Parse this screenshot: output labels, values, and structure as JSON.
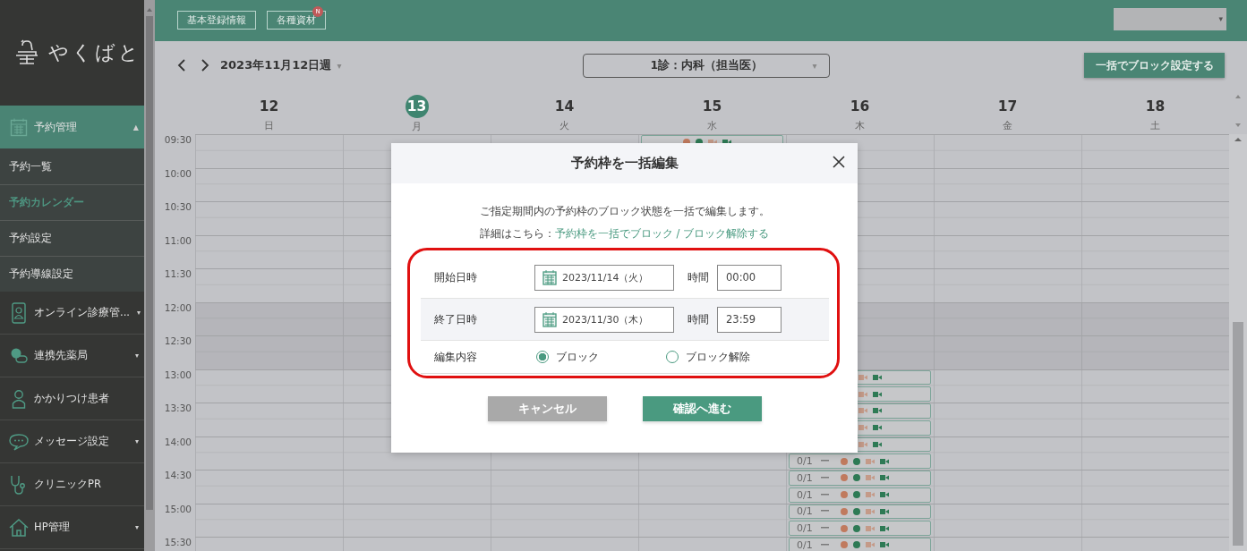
{
  "sidebar": {
    "logo": "やくばと",
    "items": [
      {
        "label": "予約管理",
        "caret": "▲",
        "selected": true,
        "children": [
          {
            "label": "予約一覧",
            "selected": false
          },
          {
            "label": "予約カレンダー",
            "selected": true
          },
          {
            "label": "予約設定",
            "selected": false
          },
          {
            "label": "予約導線設定",
            "selected": false
          }
        ]
      },
      {
        "label": "オンライン診療管...",
        "caret": "▾",
        "selected": false
      },
      {
        "label": "連携先薬局",
        "caret": "▾",
        "selected": false
      },
      {
        "label": "かかりつけ患者",
        "selected": false
      },
      {
        "label": "メッセージ設定",
        "caret": "▾",
        "selected": false
      },
      {
        "label": "クリニックPR",
        "selected": false
      },
      {
        "label": "HP管理",
        "caret": "▾",
        "selected": false
      }
    ]
  },
  "topbar": {
    "buttons": [
      {
        "label": "基本登録情報"
      },
      {
        "label": "各種資材",
        "badge": "N"
      }
    ],
    "account": {
      "caret": "▾"
    }
  },
  "toolbar": {
    "week": "2023年11月12日週",
    "week_caret": "▾",
    "department": "1診：内科（担当医）",
    "department_caret": "▾",
    "bulk_button": "一括でブロック設定する"
  },
  "calendar": {
    "days": [
      {
        "date": "12",
        "weekday": "日",
        "selected": false
      },
      {
        "date": "13",
        "weekday": "月",
        "selected": true
      },
      {
        "date": "14",
        "weekday": "火",
        "selected": false
      },
      {
        "date": "15",
        "weekday": "水",
        "selected": false,
        "slots": [
          {
            "kind": "full"
          }
        ]
      },
      {
        "date": "16",
        "weekday": "木",
        "selected": false,
        "slots": [
          {
            "kind": "empty"
          },
          {
            "kind": "empty"
          },
          {
            "kind": "empty"
          },
          {
            "kind": "empty"
          },
          {
            "kind": "empty"
          },
          {
            "kind": "empty"
          },
          {
            "kind": "empty"
          },
          {
            "kind": "empty"
          },
          {
            "kind": "empty"
          },
          {
            "kind": "empty"
          },
          {
            "kind": "empty"
          },
          {
            "kind": "empty"
          },
          {
            "kind": "empty"
          },
          {
            "kind": "empty"
          },
          {
            "kind": "partial"
          },
          {
            "kind": "partial"
          },
          {
            "kind": "partial"
          },
          {
            "kind": "partial"
          },
          {
            "kind": "partial"
          },
          {
            "kind": "full",
            "count": "0/1",
            "dash": "ー"
          },
          {
            "kind": "full",
            "count": "0/1",
            "dash": "ー"
          },
          {
            "kind": "full",
            "count": "0/1",
            "dash": "ー"
          },
          {
            "kind": "full",
            "count": "0/1",
            "dash": "ー"
          },
          {
            "kind": "full",
            "count": "0/1",
            "dash": "ー"
          },
          {
            "kind": "full",
            "count": "0/1",
            "dash": "ー"
          }
        ]
      },
      {
        "date": "17",
        "weekday": "金",
        "selected": false
      },
      {
        "date": "18",
        "weekday": "土",
        "selected": false
      }
    ],
    "times": [
      {
        "label": "09:30",
        "lunch": false
      },
      {
        "label": "10:00",
        "lunch": false
      },
      {
        "label": "10:30",
        "lunch": false
      },
      {
        "label": "11:00",
        "lunch": false
      },
      {
        "label": "11:30",
        "lunch": false
      },
      {
        "label": "12:00",
        "lunch": true
      },
      {
        "label": "12:30",
        "lunch": true
      },
      {
        "label": "13:00",
        "lunch": false
      },
      {
        "label": "13:30",
        "lunch": false
      },
      {
        "label": "14:00",
        "lunch": false
      },
      {
        "label": "14:30",
        "lunch": false
      },
      {
        "label": "15:00",
        "lunch": false
      },
      {
        "label": "15:30",
        "lunch": false
      }
    ]
  },
  "modal": {
    "title": "予約枠を一括編集",
    "description": "ご指定期間内の予約枠のブロック状態を一括で編集します。",
    "details_prefix": "詳細はこちら：",
    "details_link": "予約枠を一括でブロック / ブロック解除する",
    "highlighted": true,
    "rows": [
      {
        "kind": "datetime",
        "label": "開始日時",
        "date": "2023/11/14（火）",
        "time_label": "時間",
        "time": "00:00"
      },
      {
        "kind": "datetime",
        "label": "終了日時",
        "date": "2023/11/30（木）",
        "time_label": "時間",
        "time": "23:59"
      },
      {
        "kind": "radio",
        "label": "編集内容",
        "options": [
          {
            "label": "ブロック",
            "selected": true
          },
          {
            "label": "ブロック解除",
            "selected": false
          }
        ]
      }
    ],
    "buttons": [
      {
        "kind": "cancel",
        "label": "キャンセル"
      },
      {
        "kind": "primary",
        "label": "確認へ進む"
      }
    ]
  }
}
